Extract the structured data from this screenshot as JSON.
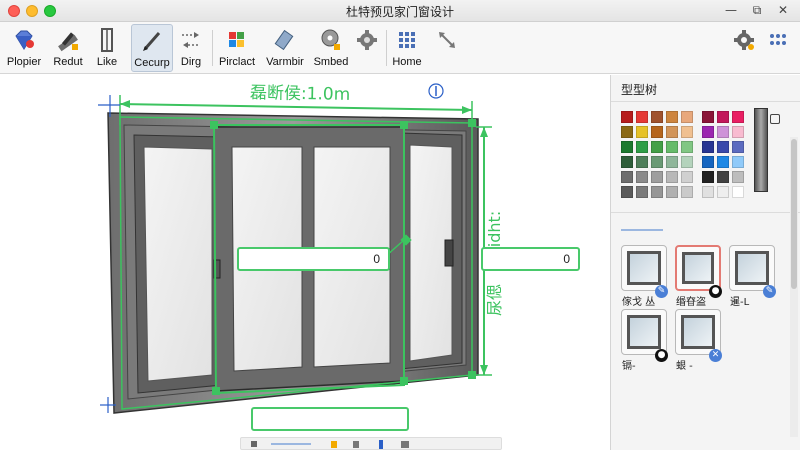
{
  "window": {
    "title": "杜特预见家门窗设计"
  },
  "toolbar": {
    "items": [
      {
        "label": "Plopier",
        "icon": "gem-icon"
      },
      {
        "label": "Redut",
        "icon": "ruler-pencil-icon"
      },
      {
        "label": "Like",
        "icon": "frame-icon"
      },
      {
        "label": "Cecurp",
        "icon": "pencil-icon",
        "active": true
      },
      {
        "label": "Dirg",
        "icon": "arrows-icon"
      },
      {
        "label": "Pirclact",
        "icon": "palette-icon"
      },
      {
        "label": "Varmbir",
        "icon": "eraser-icon"
      },
      {
        "label": "Smbed",
        "icon": "cd-icon"
      },
      {
        "label": "Home",
        "icon": "grid-icon"
      },
      {
        "label": "",
        "icon": "diagonal-arrow-icon"
      }
    ],
    "right_icons": [
      "gear-icon",
      "dots-grid-icon"
    ]
  },
  "canvas": {
    "dimension_top": "磊断侯:1.0m",
    "dimension_right_top": "Hidht:",
    "dimension_right_bottom": "尿偲",
    "input_center_value": "0",
    "input_right_value": "0",
    "input_bottom_value": "",
    "accent": "#3cc35f"
  },
  "panel": {
    "title": "型型树",
    "swatch_colors": [
      [
        "#b71c1c",
        "#e53935",
        "#a0522d",
        "#cd853f",
        "#e8a87c",
        "#8b1538",
        "#c2185b",
        "#e91e63"
      ],
      [
        "#8b6914",
        "#e6c229",
        "#b5651d",
        "#d2955a",
        "#f0c090",
        "#9c27b0",
        "#ce93d8",
        "#f8bbd0"
      ],
      [
        "#1b7a2e",
        "#2e9e47",
        "#43a047",
        "#66bb6a",
        "#81c784",
        "#283593",
        "#3949ab",
        "#5c6bc0"
      ],
      [
        "#2e5e3a",
        "#4f7f5a",
        "#6a9a75",
        "#8fb69a",
        "#b4d3bc",
        "#1565c0",
        "#1e88e5",
        "#90caf9"
      ],
      [
        "#6d6d6d",
        "#8a8a8a",
        "#9e9e9e",
        "#b8b8b8",
        "#d0d0d0",
        "#212121",
        "#424242",
        "#bdbdbd"
      ],
      [
        "#5a5a5a",
        "#7a7a7a",
        "#969696",
        "#b0b0b0",
        "#cacaca",
        "#e0e0e0",
        "#eeeeee",
        "#ffffff"
      ]
    ],
    "thumbnails": [
      {
        "label": "傢戈 丛",
        "badge": "✎",
        "badge_color": "#4a7fd6",
        "selected": false
      },
      {
        "label": "缗昚盗",
        "badge": "●",
        "badge_color": "#111111",
        "selected": true
      },
      {
        "label": "暹-L",
        "badge": "✎",
        "badge_color": "#4a7fd6",
        "selected": false
      },
      {
        "label": "镉-",
        "badge": "●",
        "badge_color": "#111111",
        "selected": false
      },
      {
        "label": "蛝 -",
        "badge": "✕",
        "badge_color": "#4a7fd6",
        "selected": false
      }
    ]
  }
}
